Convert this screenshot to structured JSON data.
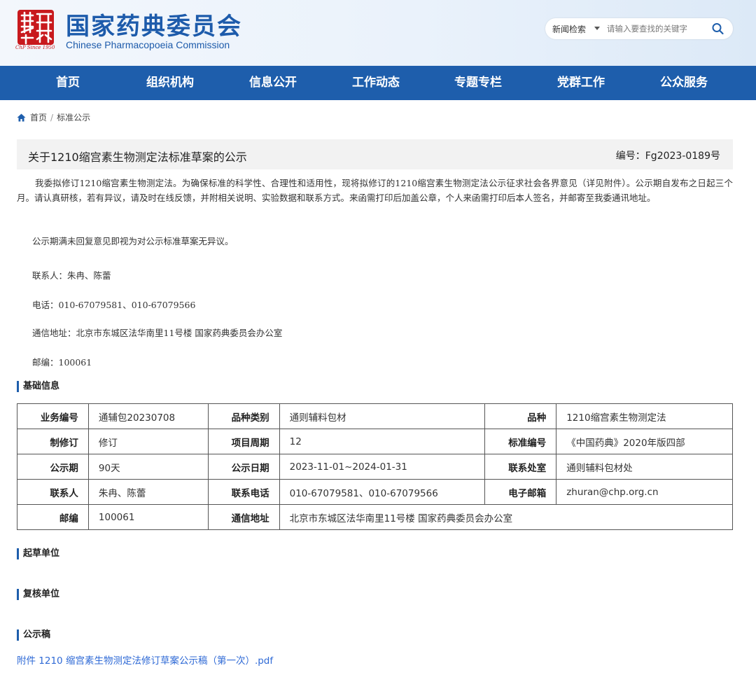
{
  "header": {
    "title_cn": "国家药典委员会",
    "title_en": "Chinese Pharmacopoeia Commission",
    "logo_text": "ChP Since 1950",
    "search": {
      "type_label": "新闻检索",
      "placeholder": "请输入要查找的关键字"
    }
  },
  "nav": {
    "items": [
      {
        "label": "首页"
      },
      {
        "label": "组织机构"
      },
      {
        "label": "信息公开"
      },
      {
        "label": "工作动态"
      },
      {
        "label": "专题专栏"
      },
      {
        "label": "党群工作"
      },
      {
        "label": "公众服务"
      }
    ]
  },
  "breadcrumb": {
    "home": "首页",
    "separator": "/",
    "current": "标准公示"
  },
  "article": {
    "title": "关于1210缩宫素生物测定法标准草案的公示",
    "number": "编号：Fg2023-0189号",
    "para1": "我委拟修订1210缩宫素生物测定法。为确保标准的科学性、合理性和适用性，现将拟修订的1210缩宫素生物测定法公示征求社会各界意见（详见附件）。公示期自发布之日起三个月。请认真研核，若有异议，请及时在线反馈，并附相关说明、实验数据和联系方式。来函需打印后加盖公章，个人来函需打印后本人签名，并邮寄至我委通讯地址。",
    "para2": "公示期满未回复意见即视为对公示标准草案无异议。",
    "contact": "联系人：朱冉、陈蕾",
    "phone": "电话：010-67079581、010-67079566",
    "address": "通信地址：北京市东城区法华南里11号楼 国家药典委员会办公室",
    "postcode": "邮编：100061"
  },
  "sections": {
    "basic": "基础信息",
    "drafter": "起草单位",
    "reviewer": "复核单位",
    "draft_doc": "公示稿"
  },
  "info_table": {
    "rows": [
      [
        "业务编号",
        "通辅包20230708",
        "品种类别",
        "通则辅料包材",
        "品种",
        "1210缩宫素生物测定法"
      ],
      [
        "制修订",
        "修订",
        "项目周期",
        "12",
        "标准编号",
        "《中国药典》2020年版四部"
      ],
      [
        "公示期",
        "90天",
        "公示日期",
        "2023-11-01~2024-01-31",
        "联系处室",
        "通则辅料包材处"
      ],
      [
        "联系人",
        "朱冉、陈蕾",
        "联系电话",
        "010-67079581、010-67079566",
        "电子邮箱",
        "zhuran@chp.org.cn"
      ],
      [
        "邮编",
        "100061",
        "通信地址",
        "北京市东城区法华南里11号楼 国家药典委员会办公室"
      ]
    ]
  },
  "attachment": {
    "label": "附件 1210 缩宫素生物测定法修订草案公示稿（第一次）.pdf"
  },
  "colors": {
    "brand_blue": "#1e5eac",
    "seal_red": "#c8191d",
    "link_blue": "#2f6ad6"
  },
  "icons": [
    "seal-logo-icon",
    "chevron-down-icon",
    "search-icon",
    "home-icon"
  ]
}
